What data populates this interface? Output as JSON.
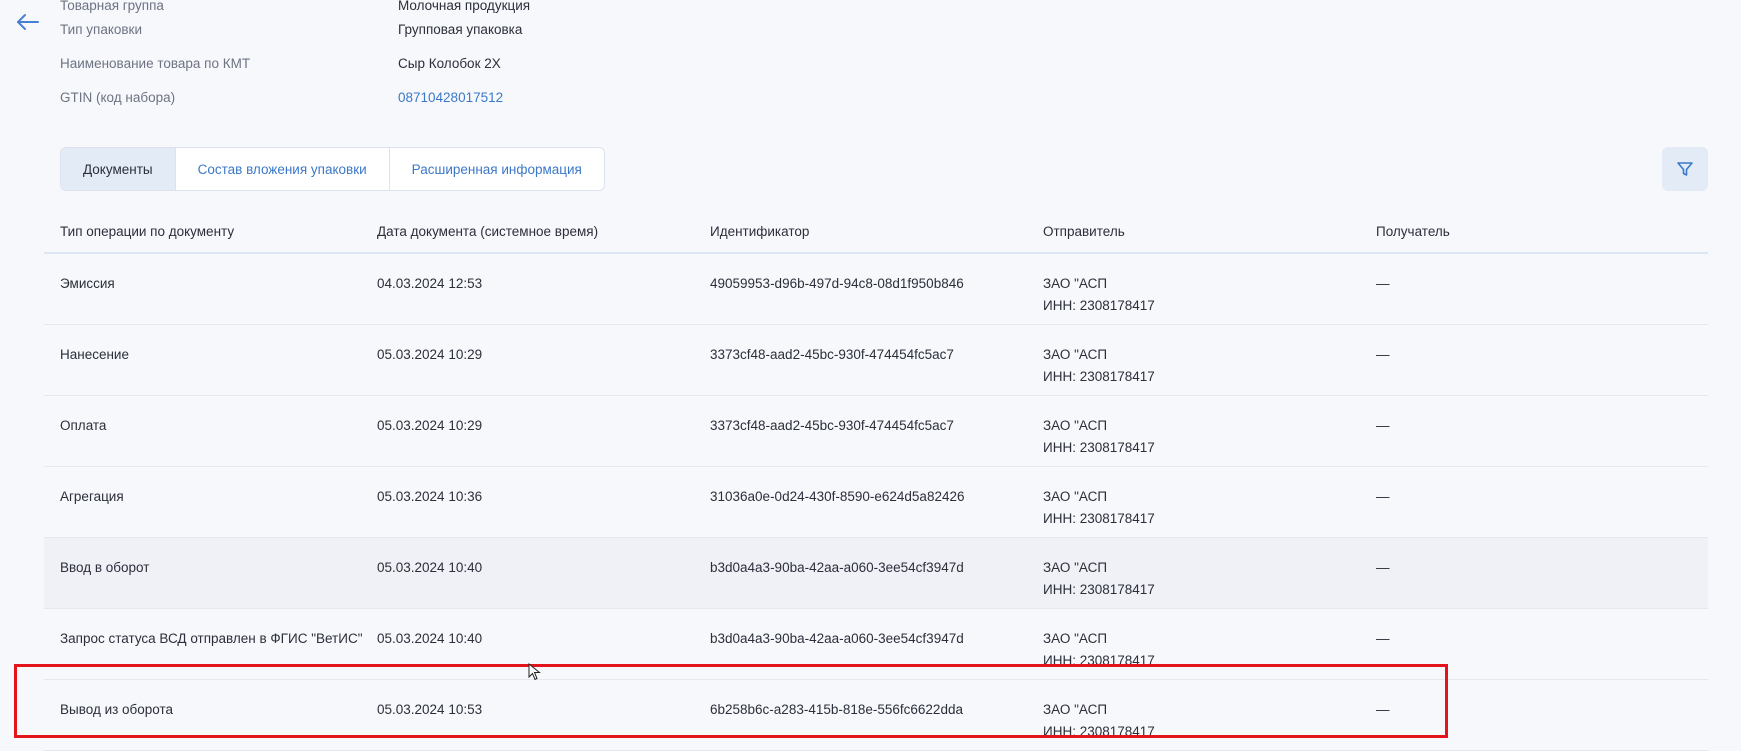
{
  "info": {
    "rows": [
      {
        "label": "Товарная группа",
        "value": "Молочная продукция"
      },
      {
        "label": "Тип упаковки",
        "value": "Групповая упаковка"
      },
      {
        "label": "Наименование товара по КМТ",
        "value": "Сыр Колобок 2Х"
      },
      {
        "label": "GTIN (код набора)",
        "value": "08710428017512"
      }
    ]
  },
  "tabs": {
    "documents": "Документы",
    "contents": "Состав вложения упаковки",
    "extended": "Расширенная информация",
    "active": "documents"
  },
  "icons": {
    "back": "arrow-left-icon",
    "filter": "filter-icon",
    "cursor": "mouse-pointer-icon"
  },
  "colors": {
    "accent": "#3c78c8",
    "highlight": "#e3141b"
  },
  "table": {
    "headers": {
      "op_type": "Тип операции по документу",
      "doc_date": "Дата документа (системное время)",
      "identifier": "Идентификатор",
      "sender": "Отправитель",
      "receiver": "Получатель"
    },
    "rows": [
      {
        "op_type": "Эмиссия",
        "doc_date": "04.03.2024 12:53",
        "identifier": "49059953-d96b-497d-94c8-08d1f950b846",
        "sender_name": "ЗАО \"АСП",
        "sender_inn": "ИНН: 2308178417",
        "receiver": "—"
      },
      {
        "op_type": "Нанесение",
        "doc_date": "05.03.2024 10:29",
        "identifier": "3373cf48-aad2-45bc-930f-474454fc5ac7",
        "sender_name": "ЗАО \"АСП",
        "sender_inn": "ИНН: 2308178417",
        "receiver": "—"
      },
      {
        "op_type": "Оплата",
        "doc_date": "05.03.2024 10:29",
        "identifier": "3373cf48-aad2-45bc-930f-474454fc5ac7",
        "sender_name": "ЗАО \"АСП",
        "sender_inn": "ИНН: 2308178417",
        "receiver": "—"
      },
      {
        "op_type": "Агрегация",
        "doc_date": "05.03.2024 10:36",
        "identifier": "31036a0e-0d24-430f-8590-e624d5a82426",
        "sender_name": "ЗАО \"АСП",
        "sender_inn": "ИНН: 2308178417",
        "receiver": "—"
      },
      {
        "op_type": "Ввод в оборот",
        "doc_date": "05.03.2024 10:40",
        "identifier": "b3d0a4a3-90ba-42aa-a060-3ee54cf3947d",
        "sender_name": "ЗАО \"АСП",
        "sender_inn": "ИНН: 2308178417",
        "receiver": "—"
      },
      {
        "op_type": "Запрос статуса ВСД отправлен в ФГИС \"ВетИС\"",
        "doc_date": "05.03.2024 10:40",
        "identifier": "b3d0a4a3-90ba-42aa-a060-3ee54cf3947d",
        "sender_name": "ЗАО \"АСП",
        "sender_inn": "ИНН: 2308178417",
        "receiver": "—"
      },
      {
        "op_type": "Вывод из оборота",
        "doc_date": "05.03.2024 10:53",
        "identifier": "6b258b6c-a283-415b-818e-556fc6622dda",
        "sender_name": "ЗАО \"АСП",
        "sender_inn": "ИНН: 2308178417",
        "receiver": "—"
      }
    ]
  }
}
